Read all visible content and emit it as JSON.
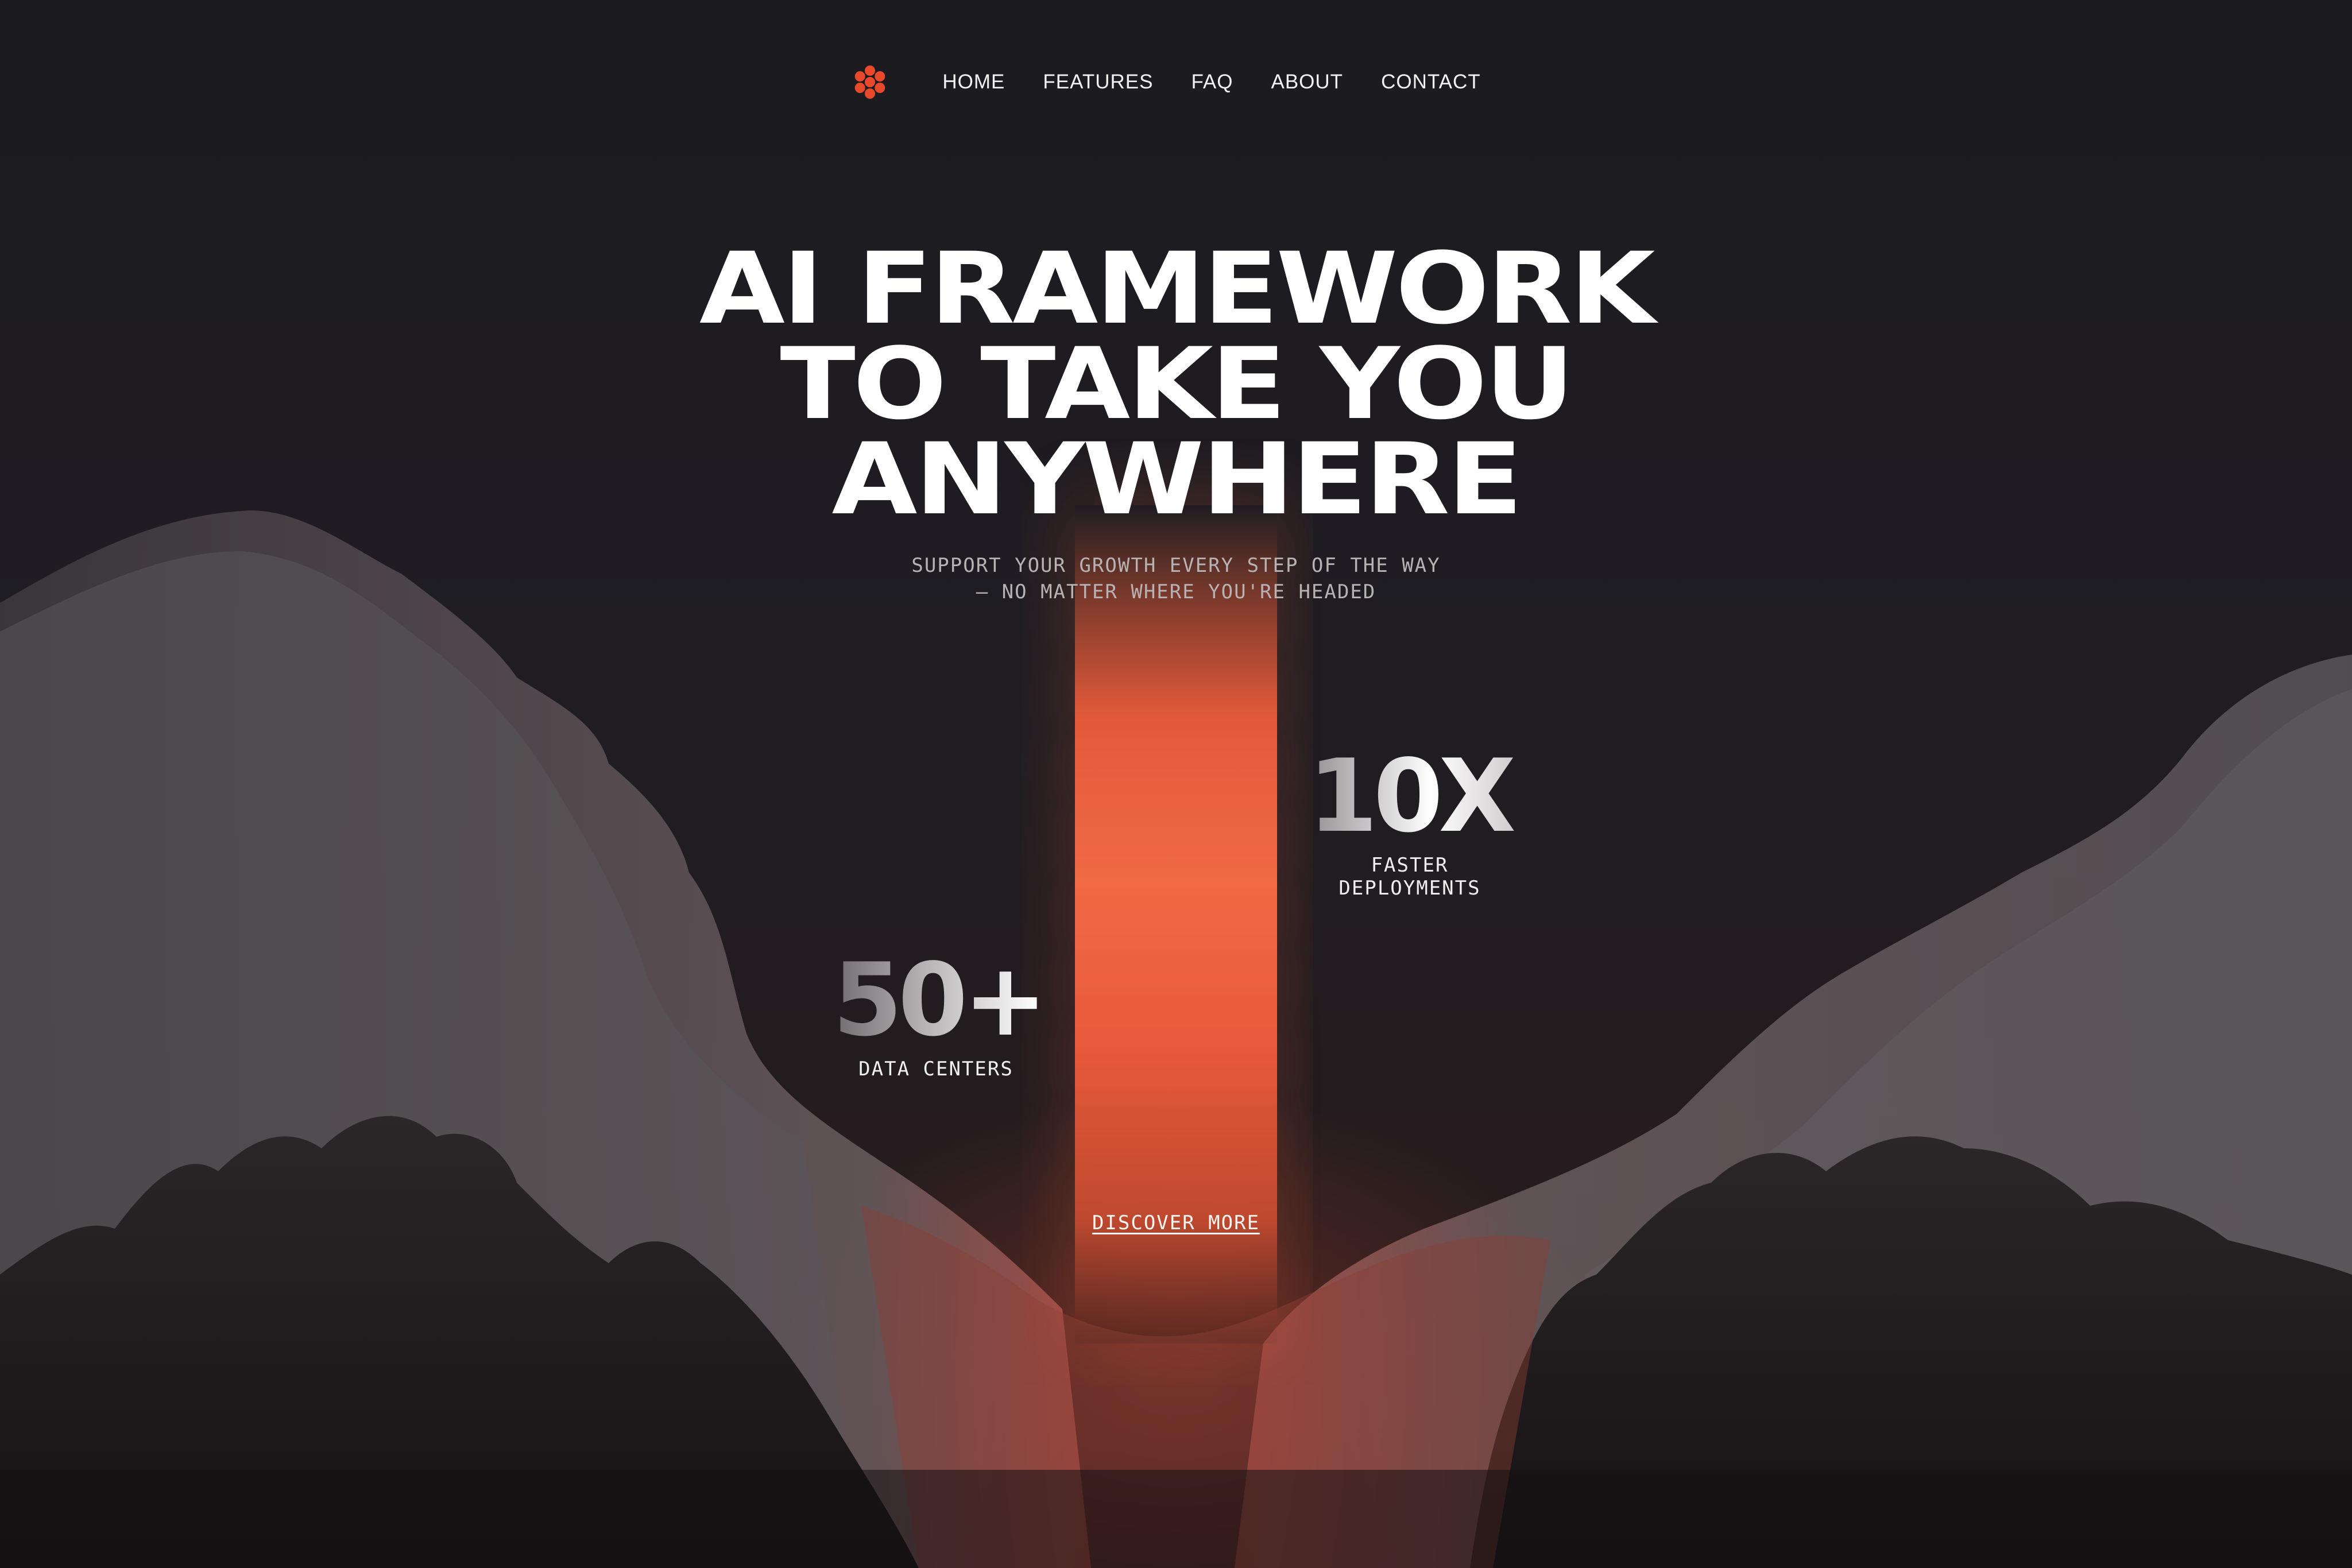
{
  "nav": {
    "logo_icon": "orange-flower-logo-icon",
    "items": [
      {
        "label": "HOME"
      },
      {
        "label": "FEATURES"
      },
      {
        "label": "FAQ"
      },
      {
        "label": "ABOUT"
      },
      {
        "label": "CONTACT"
      }
    ]
  },
  "hero": {
    "title_lines": [
      "AI FRAMEWORK",
      "TO TAKE YOU",
      "ANYWHERE"
    ],
    "subtitle_lines": [
      "SUPPORT YOUR GROWTH EVERY STEP OF THE WAY",
      "— NO MATTER WHERE YOU'RE HEADED"
    ]
  },
  "stats": [
    {
      "value": "10X",
      "label": "FASTER DEPLOYMENTS"
    },
    {
      "value": "50+",
      "label": "DATA CENTERS"
    }
  ],
  "cta": {
    "label": "DISCOVER MORE"
  },
  "colors": {
    "background": "#1e1c21",
    "accent": "#f06a44",
    "logo": "#e8492a",
    "text": "#ffffff"
  }
}
